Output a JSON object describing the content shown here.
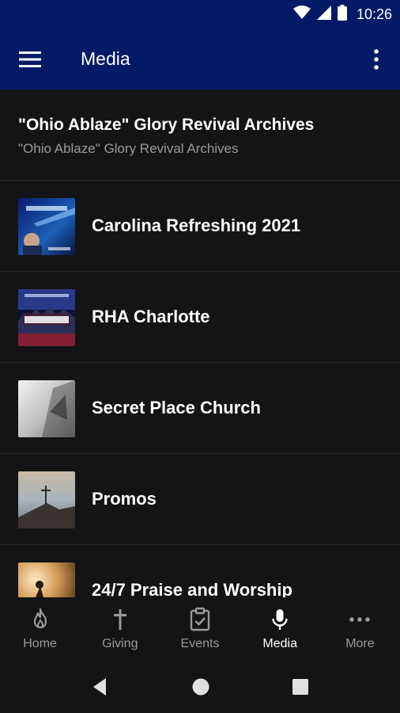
{
  "status_bar": {
    "time": "10:26"
  },
  "app_bar": {
    "title": "Media",
    "accent_color": "#041a66"
  },
  "header": {
    "title": "\"Ohio Ablaze\" Glory Revival Archives",
    "subtitle": "\"Ohio Ablaze\" Glory Revival Archives"
  },
  "list": {
    "items": [
      {
        "label": "Carolina Refreshing 2021",
        "thumb_text": "CAROLINA"
      },
      {
        "label": "RHA Charlotte",
        "thumb_text": "AMERICA"
      },
      {
        "label": "Secret Place Church"
      },
      {
        "label": "Promos"
      },
      {
        "label": "24/7 Praise and Worship"
      }
    ]
  },
  "tabs": [
    {
      "label": "Home",
      "icon": "flame-icon"
    },
    {
      "label": "Giving",
      "icon": "cross-icon"
    },
    {
      "label": "Events",
      "icon": "calendar-check-icon"
    },
    {
      "label": "Media",
      "icon": "microphone-icon",
      "active": true
    },
    {
      "label": "More",
      "icon": "more-horizontal-icon"
    }
  ],
  "colors": {
    "background": "#141416",
    "divider": "#2a2a2d",
    "inactive": "#9a9a9c"
  }
}
